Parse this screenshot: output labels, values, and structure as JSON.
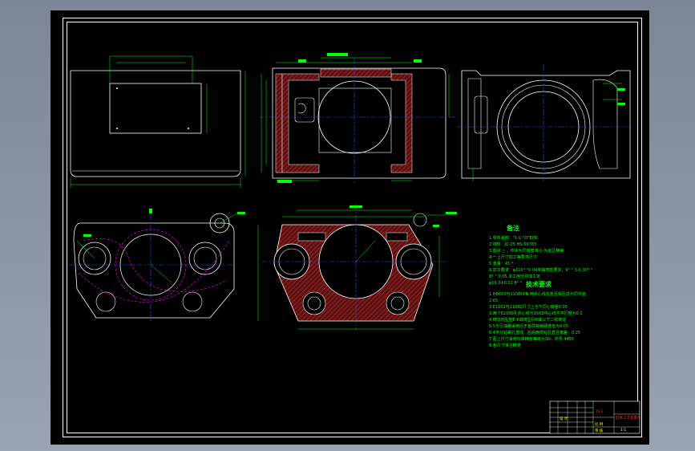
{
  "notes": {
    "title": "备注",
    "lines": [
      "1.零件名称：\"1 U \"O\"缸体.",
      "2.材料：JC-25 HS-56783",
      "3.图中 △ ，件中为同名基准小 为此区精等",
      "4.一上尺寸加工等要求尺寸",
      "5.重量：45 *",
      "6.加工要求：φ110° °0.04单独按直要求，9° ° 3-0.30° °",
      "   8° ° 0.05,本工序分别加工定",
      "φ16.0±0.01 8* *"
    ]
  },
  "requirements": {
    "title": "技术要求",
    "lines": [
      "1.HB650与1108KPN,两中心线在各互相互成为同平面",
      "2.65",
      "3.E1102与1108Z尺寸上与下同心偏差0.05",
      "3.两个E2200孔中心线与150Z中心线不平行度为0.1",
      "4.铸造时型腔E-6或铸型砂6或以下二级铸造",
      "5.5与引油路采用后于各层特种硬度值为0.05",
      "6.4平分钻螺孔直线、后组两侧钻孔直径偏差：0.25",
      "7.图上尺寸采用标准精度等级为3D，件号 4455",
      "8.各尺寸未注精度"
    ]
  },
  "title_block": {
    "drawing_no": "JS-2",
    "part_name": "缸体工艺装置4",
    "sheet": "1:1",
    "scale_label": "比 例",
    "designer": "设 计",
    "checker": "审 核"
  },
  "colors": {
    "background": "#000000",
    "frame": "#ffffff",
    "outline": "#ffffff",
    "center_line": "#2a4cff",
    "dimension": "#00ff00",
    "hatch": "#8b1a1a",
    "dashed": "#ff00ff",
    "annotation": "#00ff00",
    "title_block": "#ffff00"
  }
}
